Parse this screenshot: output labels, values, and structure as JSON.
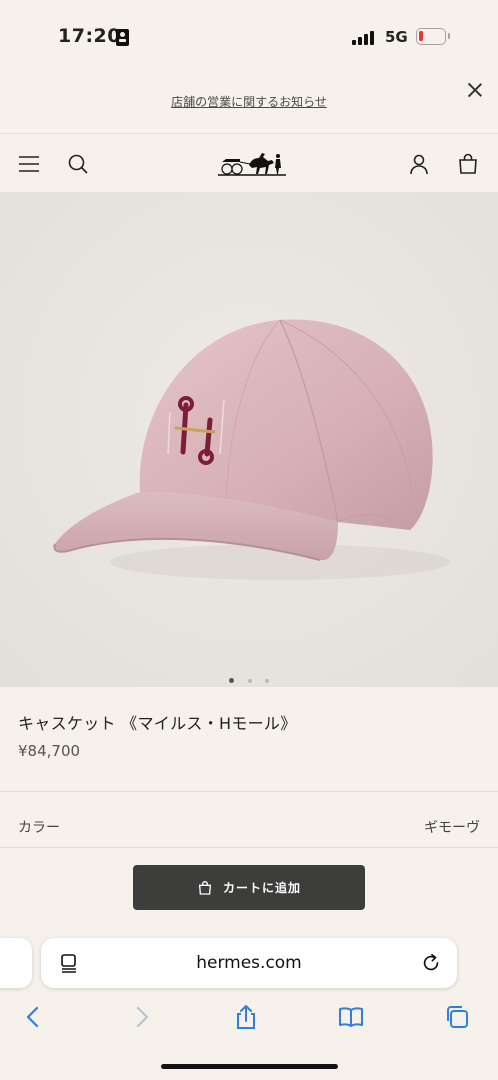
{
  "status_bar": {
    "time": "17:20",
    "network": "5G",
    "battery_color": "#e53935"
  },
  "notice": {
    "link_text": "店舗の営業に関するお知らせ"
  },
  "header": {
    "icons": [
      "menu-icon",
      "search-icon",
      "hermes-logo",
      "account-icon",
      "bag-icon"
    ]
  },
  "carousel": {
    "total": 3,
    "active": 1
  },
  "product": {
    "title": "キャスケット 《マイルス・Hモール》",
    "price": "¥84,700",
    "color_label": "カラー",
    "color_value": "ギモーヴ",
    "cap_color": "#dcb8bc",
    "logo_color": "#7a1e3c"
  },
  "cart": {
    "button_label": "カートに追加",
    "button_color": "#3d3d3b"
  },
  "safari": {
    "url": "hermes.com",
    "accent_color": "#2f7fe0"
  }
}
